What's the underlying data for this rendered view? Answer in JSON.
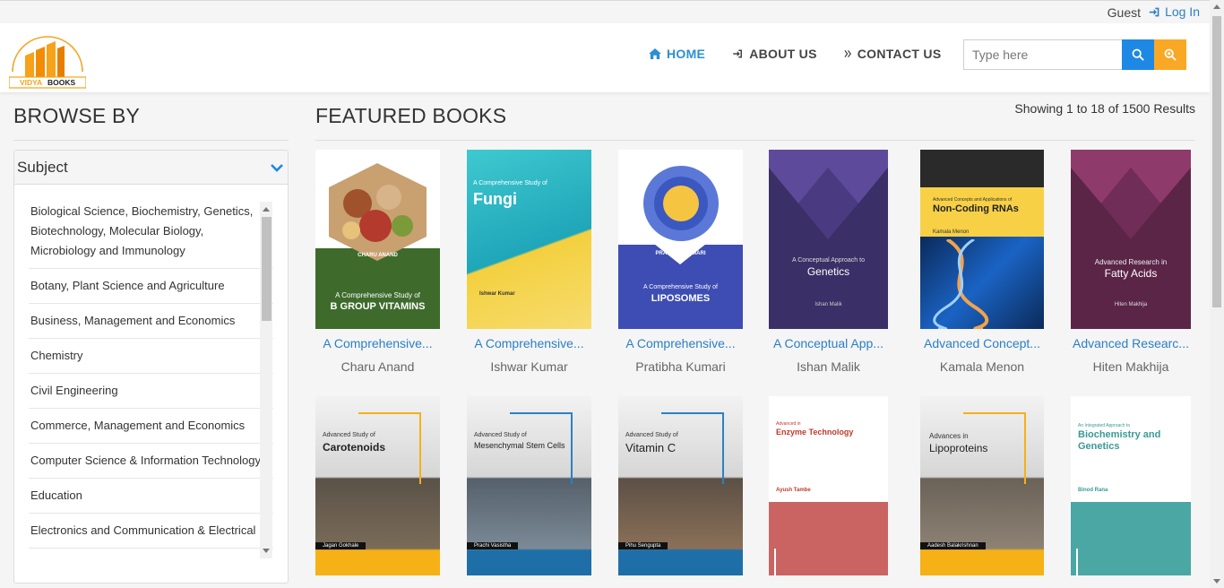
{
  "topbar": {
    "guest": "Guest",
    "login": "Log In"
  },
  "logo": {
    "text_left": "VIDYA",
    "text_right": "BOOKS"
  },
  "nav": {
    "home": "HOME",
    "about": "ABOUT US",
    "contact": "CONTACT US"
  },
  "search": {
    "placeholder": "Type here"
  },
  "sidebar": {
    "title": "BROWSE BY",
    "panel_title": "Subject",
    "subjects": [
      "Biological Science, Biochemistry, Genetics, Biotechnology, Molecular Biology, Microbiology and Immunology",
      "Botany, Plant Science and Agriculture",
      "Business, Management and Economics",
      "Chemistry",
      "Civil Engineering",
      "Commerce, Management and Economics",
      "Computer Science & Information Technology",
      "Education",
      "Electronics and Communication & Electrical"
    ]
  },
  "main": {
    "title": "FEATURED BOOKS",
    "results": "Showing 1 to 18 of 1500 Results",
    "books": [
      {
        "title": "A Comprehensive...",
        "author": "Charu Anand",
        "cover_author": "CHARU ANAND",
        "cover_line1": "A Comprehensive Study of",
        "cover_line2": "B GROUP VITAMINS"
      },
      {
        "title": "A Comprehensive...",
        "author": "Ishwar Kumar",
        "cover_author": "Ishwar Kumar",
        "cover_line1": "A Comprehensive Study of",
        "cover_line2": "Fungi"
      },
      {
        "title": "A Comprehensive...",
        "author": "Pratibha Kumari",
        "cover_author": "PRATIBHA KUMARI",
        "cover_line1": "A Comprehensive Study of",
        "cover_line2": "LIPOSOMES"
      },
      {
        "title": "A Conceptual App...",
        "author": "Ishan Malik",
        "cover_author": "Ishan Malik",
        "cover_line1": "A Conceptual Approach to",
        "cover_line2": "Genetics"
      },
      {
        "title": "Advanced Concept...",
        "author": "Kamala Menon",
        "cover_author": "Kamala Menon",
        "cover_line1": "Advanced Concepts and Applications of",
        "cover_line2": "Non-Coding RNAs"
      },
      {
        "title": "Advanced Researc...",
        "author": "Hiten Makhija",
        "cover_author": "Hiten Makhija",
        "cover_line1": "Advanced Research in",
        "cover_line2": "Fatty Acids"
      },
      {
        "cover_author": "Jagan Gokhale",
        "cover_line1": "Advanced Study of",
        "cover_line2": "Carotenoids"
      },
      {
        "cover_author": "Prachi Vasistha",
        "cover_line1": "Advanced Study of",
        "cover_line2": "Mesenchymal Stem Cells"
      },
      {
        "cover_author": "Pihu Sengupta",
        "cover_line1": "Advanced Study of",
        "cover_line2": "Vitamin C"
      },
      {
        "cover_author": "Ayush Tambe",
        "cover_line1": "Advanced in",
        "cover_line2": "Enzyme Technology"
      },
      {
        "cover_author": "Aadesh Balakrishnan",
        "cover_line1": "Advances in",
        "cover_line2": "Lipoproteins"
      },
      {
        "cover_author": "Binod Rana",
        "cover_line1": "An Integrated Approach to",
        "cover_line2": "Biochemistry and Genetics"
      }
    ]
  },
  "colors": {
    "accent_blue": "#2b8fd4",
    "search_blue": "#1e88e5",
    "search_orange": "#f9a825",
    "logo_orange": "#f7a21b"
  }
}
